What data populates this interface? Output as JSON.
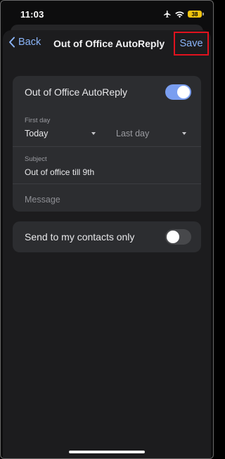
{
  "status_bar": {
    "time": "11:03",
    "battery": "38",
    "icons": [
      "airplane-icon",
      "wifi-icon",
      "battery-icon"
    ]
  },
  "nav": {
    "back_label": "Back",
    "title": "Out of Office AutoReply",
    "save_label": "Save"
  },
  "autoreply_card": {
    "toggle_label": "Out of Office AutoReply",
    "toggle_on": true,
    "first_day_label": "First day",
    "first_day_value": "Today",
    "last_day_placeholder": "Last day",
    "subject_label": "Subject",
    "subject_value": "Out of office till 9th",
    "message_placeholder": "Message"
  },
  "contacts_card": {
    "label": "Send to my contacts only",
    "toggle_on": false
  },
  "colors": {
    "accent": "#8ab4f8",
    "toggle_on": "#7a9ef0",
    "highlight_box": "#e1121e",
    "card_bg": "#2c2d30"
  }
}
